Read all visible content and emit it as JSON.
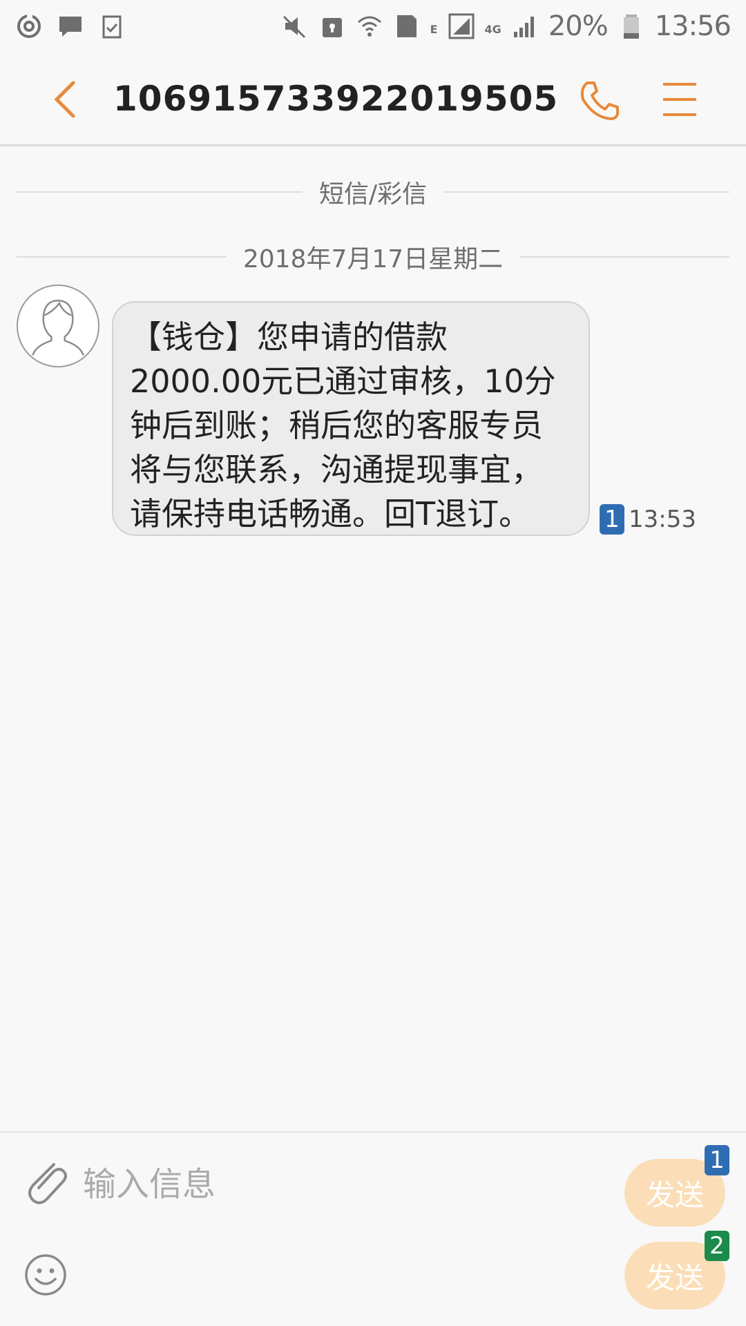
{
  "status_bar": {
    "network_type_small": "E",
    "network_4g": "4G",
    "sim_indicator": "1",
    "battery_percent": "20%",
    "time": "13:56",
    "icons": [
      "sync-icon",
      "chat-bubble-icon",
      "checklist-icon",
      "mute-icon",
      "lock-icon",
      "wifi-icon",
      "signal-icon",
      "battery-icon"
    ]
  },
  "header": {
    "contact_number": "106915733922019505",
    "icons": [
      "back-arrow-icon",
      "phone-icon",
      "menu-icon"
    ],
    "accent_color": "#e8893a"
  },
  "conversation": {
    "type_label": "短信/彩信",
    "date_label": "2018年7月17日星期二",
    "messages": [
      {
        "text": "【钱仓】您申请的借款\n2000.00元已通过审核，10分\n钟后到账；稍后您的客服专员\n将与您联系，沟通提现事宜，\n请保持电话畅通。回T退订。",
        "sim": "1",
        "time": "13:53"
      }
    ]
  },
  "composer": {
    "placeholder": "输入信息",
    "send_buttons": [
      {
        "label": "发送",
        "sim": "1",
        "sim_color": "#2f6db3"
      },
      {
        "label": "发送",
        "sim": "2",
        "sim_color": "#1c8a4a"
      }
    ],
    "send_button_color": "#fbdeb7"
  }
}
